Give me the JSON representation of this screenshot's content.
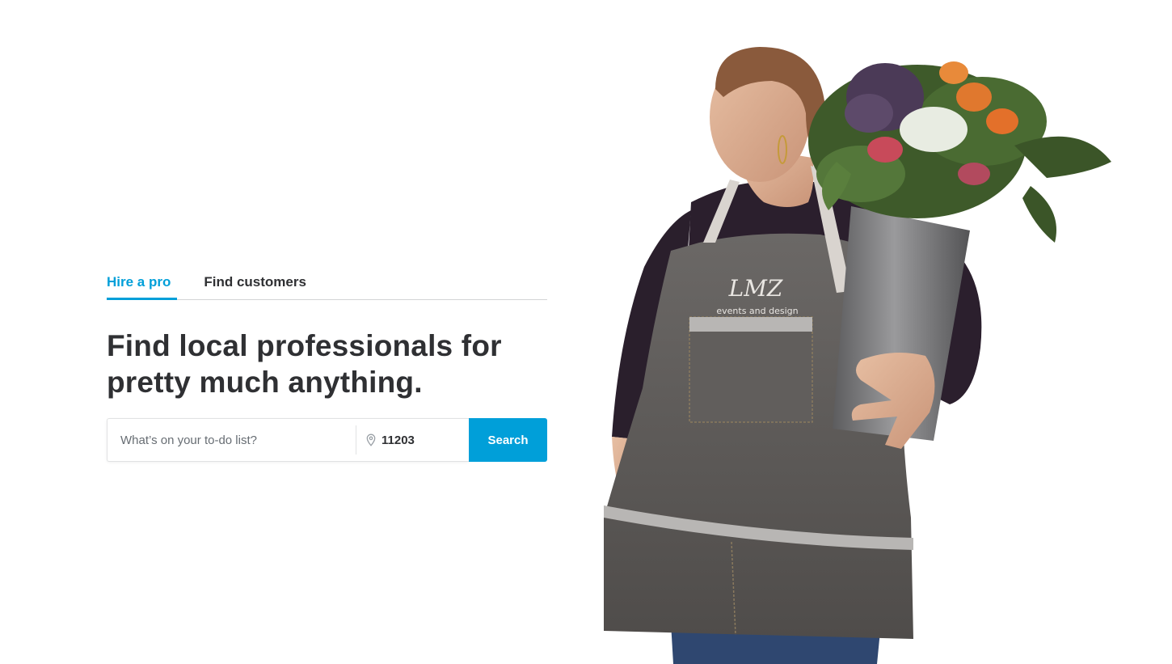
{
  "tabs": [
    {
      "label": "Hire a pro",
      "active": true
    },
    {
      "label": "Find customers",
      "active": false
    }
  ],
  "headline": "Find local professionals for pretty much anything.",
  "search": {
    "placeholder": "What’s on your to-do list?",
    "value": "",
    "zip_value": "11203",
    "button_label": "Search"
  },
  "hero_image": {
    "apron_logo": "LMZ",
    "apron_tagline": "events and design"
  },
  "colors": {
    "accent": "#009fd9",
    "text": "#2f3033"
  }
}
